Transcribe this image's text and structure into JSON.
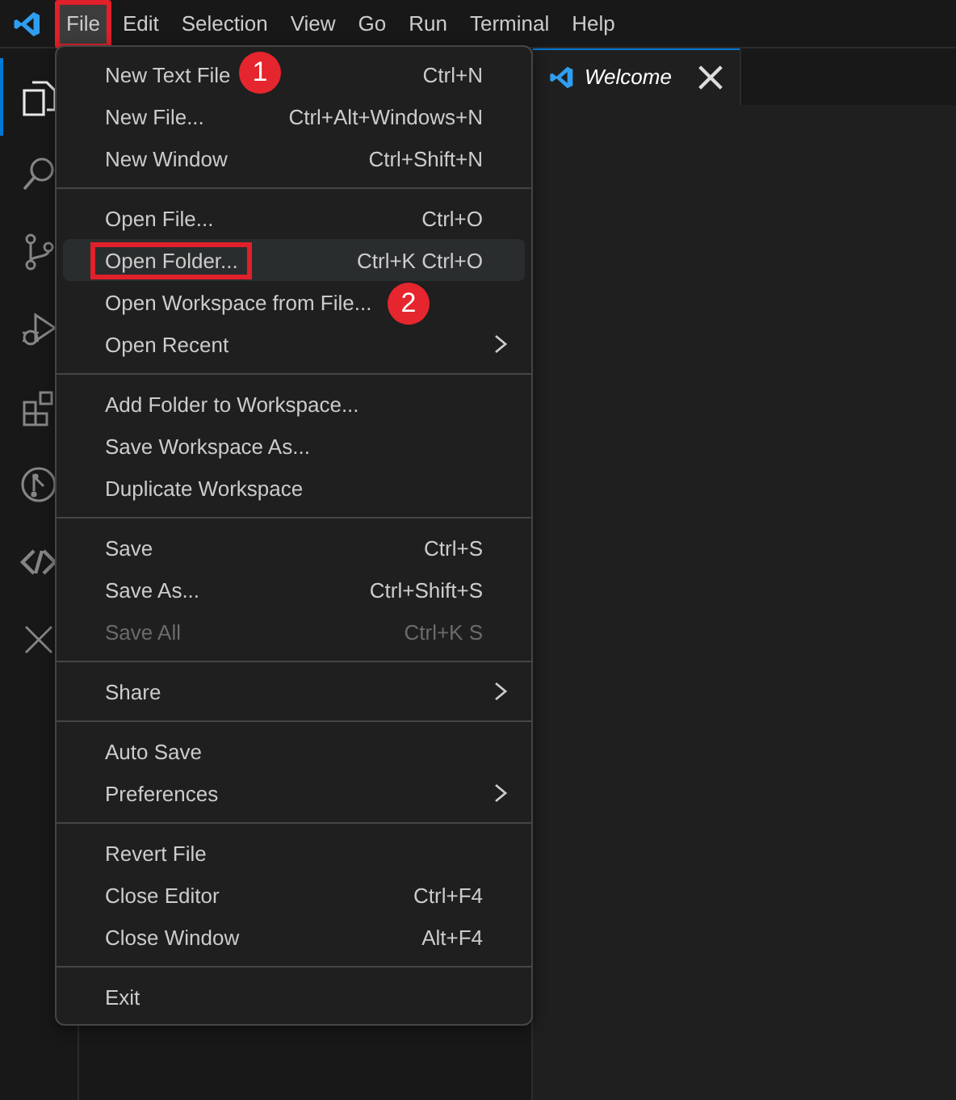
{
  "menu_bar": {
    "items": [
      {
        "label": "File",
        "selected": true,
        "highlighted": true,
        "callout": "1"
      },
      {
        "label": "Edit",
        "selected": false,
        "highlighted": false
      },
      {
        "label": "Selection",
        "selected": false,
        "highlighted": false
      },
      {
        "label": "View",
        "selected": false,
        "highlighted": false
      },
      {
        "label": "Go",
        "selected": false,
        "highlighted": false
      },
      {
        "label": "Run",
        "selected": false,
        "highlighted": false
      },
      {
        "label": "Terminal",
        "selected": false,
        "highlighted": false
      },
      {
        "label": "Help",
        "selected": false,
        "highlighted": false
      }
    ]
  },
  "activity_bar": [
    {
      "kind": "files",
      "selected": true
    },
    {
      "kind": "search",
      "selected": false
    },
    {
      "kind": "branch",
      "selected": false
    },
    {
      "kind": "debug",
      "selected": false
    },
    {
      "kind": "extensions",
      "selected": false
    },
    {
      "kind": "git-circle",
      "selected": false
    },
    {
      "kind": "code-link",
      "selected": false
    },
    {
      "kind": "cross",
      "selected": false
    }
  ],
  "tabs": [
    {
      "label": "Welcome",
      "selected": true
    }
  ],
  "file_menu": {
    "groups": [
      [
        {
          "kind": "command",
          "label": "New Text File",
          "shortcut": "Ctrl+N",
          "selected": false,
          "disabled": false,
          "highlighted": false
        },
        {
          "kind": "command",
          "label": "New File...",
          "shortcut": "Ctrl+Alt+Windows+N",
          "selected": false,
          "disabled": false,
          "highlighted": false
        },
        {
          "kind": "command",
          "label": "New Window",
          "shortcut": "Ctrl+Shift+N",
          "selected": false,
          "disabled": false,
          "highlighted": false
        }
      ],
      [
        {
          "kind": "command",
          "label": "Open File...",
          "shortcut": "Ctrl+O",
          "selected": false,
          "disabled": false,
          "highlighted": false
        },
        {
          "kind": "command",
          "label": "Open Folder...",
          "shortcut": "Ctrl+K Ctrl+O",
          "selected": true,
          "disabled": false,
          "highlighted": true,
          "callout": "2"
        },
        {
          "kind": "command",
          "label": "Open Workspace from File...",
          "selected": false,
          "disabled": false,
          "highlighted": false
        },
        {
          "kind": "submenu",
          "label": "Open Recent",
          "selected": false,
          "disabled": false,
          "highlighted": false
        }
      ],
      [
        {
          "kind": "command",
          "label": "Add Folder to Workspace...",
          "selected": false,
          "disabled": false,
          "highlighted": false
        },
        {
          "kind": "command",
          "label": "Save Workspace As...",
          "selected": false,
          "disabled": false,
          "highlighted": false
        },
        {
          "kind": "command",
          "label": "Duplicate Workspace",
          "selected": false,
          "disabled": false,
          "highlighted": false
        }
      ],
      [
        {
          "kind": "command",
          "label": "Save",
          "shortcut": "Ctrl+S",
          "selected": false,
          "disabled": false,
          "highlighted": false
        },
        {
          "kind": "command",
          "label": "Save As...",
          "shortcut": "Ctrl+Shift+S",
          "selected": false,
          "disabled": false,
          "highlighted": false
        },
        {
          "kind": "command",
          "label": "Save All",
          "shortcut": "Ctrl+K S",
          "selected": false,
          "disabled": true,
          "highlighted": false
        }
      ],
      [
        {
          "kind": "submenu",
          "label": "Share",
          "selected": false,
          "disabled": false,
          "highlighted": false
        }
      ],
      [
        {
          "kind": "command",
          "label": "Auto Save",
          "selected": false,
          "disabled": false,
          "highlighted": false
        },
        {
          "kind": "submenu",
          "label": "Preferences",
          "selected": false,
          "disabled": false,
          "highlighted": false
        }
      ],
      [
        {
          "kind": "command",
          "label": "Revert File",
          "selected": false,
          "disabled": false,
          "highlighted": false
        },
        {
          "kind": "command",
          "label": "Close Editor",
          "shortcut": "Ctrl+F4",
          "selected": false,
          "disabled": false,
          "highlighted": false
        },
        {
          "kind": "command",
          "label": "Close Window",
          "shortcut": "Alt+F4",
          "selected": false,
          "disabled": false,
          "highlighted": false
        }
      ],
      [
        {
          "kind": "command",
          "label": "Exit",
          "selected": false,
          "disabled": false,
          "highlighted": false
        }
      ]
    ]
  }
}
